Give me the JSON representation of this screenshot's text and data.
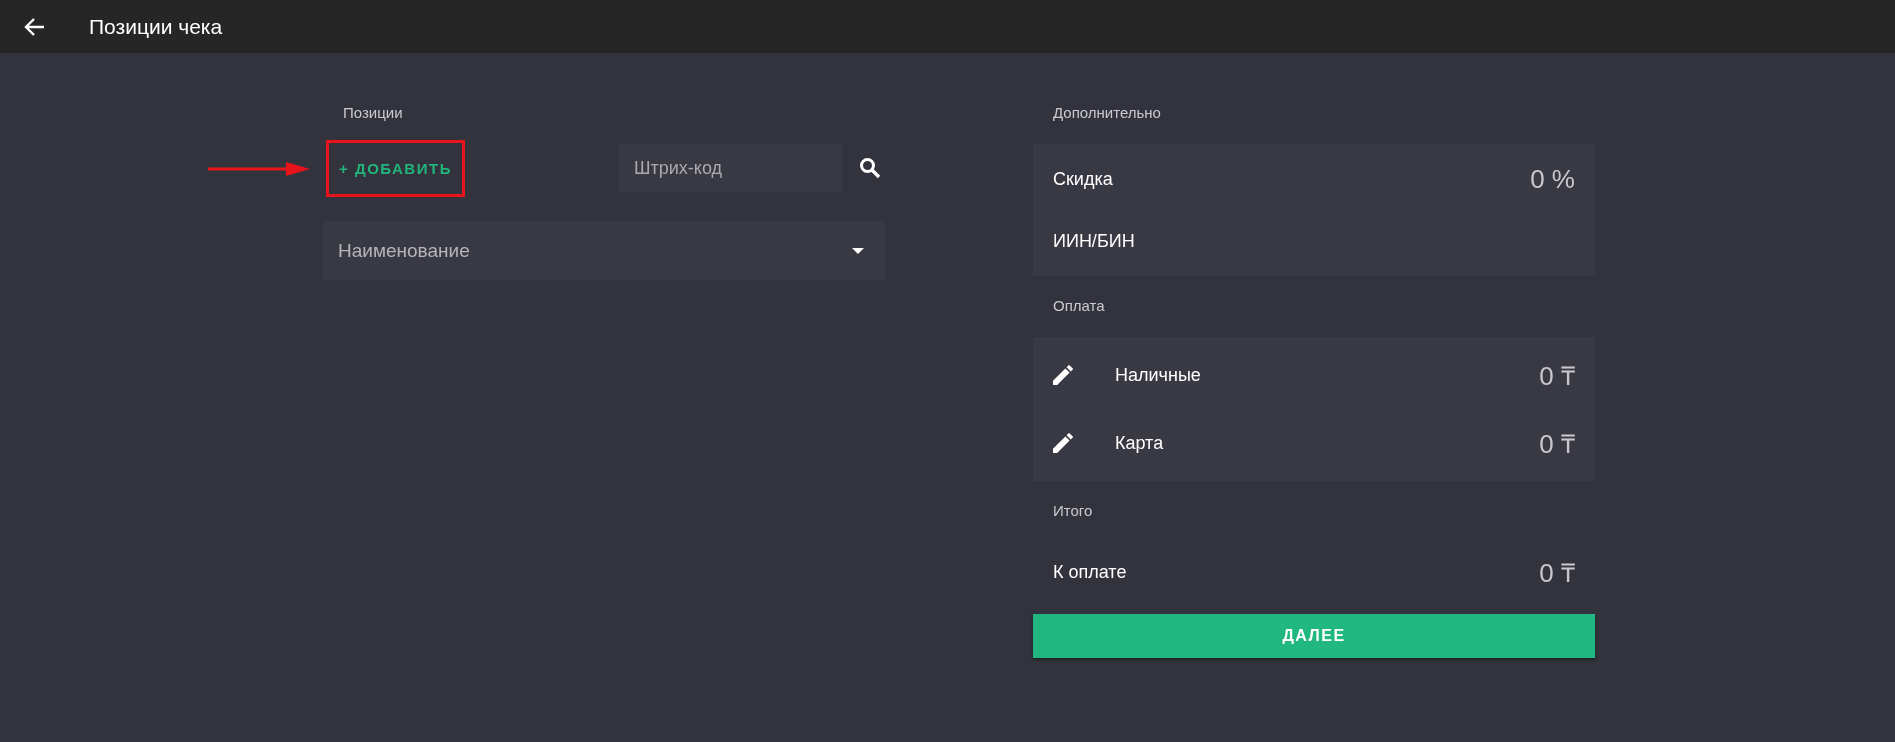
{
  "header": {
    "title": "Позиции чека"
  },
  "positions": {
    "label": "Позиции",
    "add_button": {
      "label": "+ ДОБАВИТЬ",
      "highlighted": true
    },
    "barcode": {
      "placeholder": "Штрих-код"
    },
    "name_select": {
      "placeholder": "Наименование"
    }
  },
  "extra": {
    "label": "Дополнительно",
    "rows": [
      {
        "label": "Скидка",
        "value": "0 %"
      },
      {
        "label": "ИИН/БИН"
      }
    ]
  },
  "payment": {
    "label": "Оплата",
    "rows": [
      {
        "label": "Наличные",
        "value": "0 ₸"
      },
      {
        "label": "Карта",
        "value": "0 ₸"
      }
    ]
  },
  "total": {
    "label": "Итого",
    "rows": [
      {
        "label": "К оплате",
        "value": "0 ₸"
      }
    ]
  },
  "next_button": {
    "label": "ДАЛЕЕ"
  }
}
